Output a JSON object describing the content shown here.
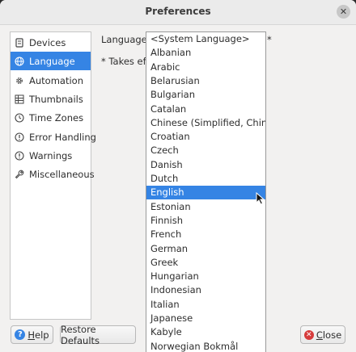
{
  "window": {
    "title": "Preferences",
    "close_glyph": "✕"
  },
  "sidebar": {
    "items": [
      {
        "label": "Devices",
        "icon": "device-icon"
      },
      {
        "label": "Language",
        "icon": "globe-icon",
        "active": true
      },
      {
        "label": "Automation",
        "icon": "gear-icon"
      },
      {
        "label": "Thumbnails",
        "icon": "grid-icon"
      },
      {
        "label": "Time Zones",
        "icon": "clock-icon"
      },
      {
        "label": "Error Handling",
        "icon": "error-icon"
      },
      {
        "label": "Warnings",
        "icon": "warning-icon"
      },
      {
        "label": "Miscellaneous",
        "icon": "wrench-icon"
      }
    ]
  },
  "language": {
    "label": "Language:",
    "asterisk": "*",
    "note": "* Takes effe",
    "selected": "English",
    "options": [
      "<System Language>",
      "Albanian",
      "Arabic",
      "Belarusian",
      "Bulgarian",
      "Catalan",
      "Chinese (Simplified, China)",
      "Croatian",
      "Czech",
      "Danish",
      "Dutch",
      "English",
      "Estonian",
      "Finnish",
      "French",
      "German",
      "Greek",
      "Hungarian",
      "Indonesian",
      "Italian",
      "Japanese",
      "Kabyle",
      "Norwegian Bokmål"
    ]
  },
  "buttons": {
    "help_mnemonic": "H",
    "help_rest": "elp",
    "restore": "Restore Defaults",
    "close_mnemonic": "C",
    "close_rest": "lose"
  },
  "colors": {
    "accent": "#3584e4",
    "close_icon": "#d63c3c"
  }
}
